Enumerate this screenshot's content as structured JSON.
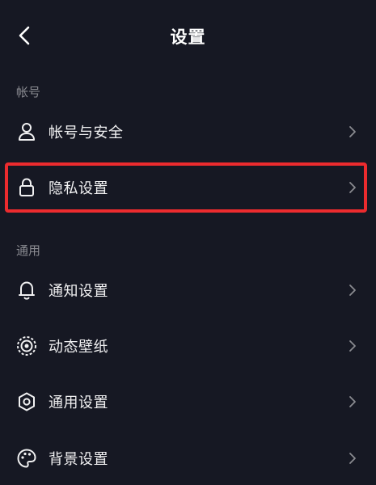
{
  "header": {
    "title": "设置",
    "back_icon": "chevron-left-icon"
  },
  "sections": [
    {
      "label": "帐号",
      "items": [
        {
          "label": "帐号与安全",
          "icon": "user-icon"
        },
        {
          "label": "隐私设置",
          "icon": "lock-icon",
          "highlighted": true
        }
      ]
    },
    {
      "label": "通用",
      "items": [
        {
          "label": "通知设置",
          "icon": "bell-icon"
        },
        {
          "label": "动态壁纸",
          "icon": "live-wallpaper-icon"
        },
        {
          "label": "通用设置",
          "icon": "gear-icon"
        },
        {
          "label": "背景设置",
          "icon": "palette-icon"
        }
      ]
    }
  ],
  "colors": {
    "background": "#161823",
    "text": "#f1f1f2",
    "muted": "#8a8b91",
    "highlight": "#ec2b2e"
  }
}
